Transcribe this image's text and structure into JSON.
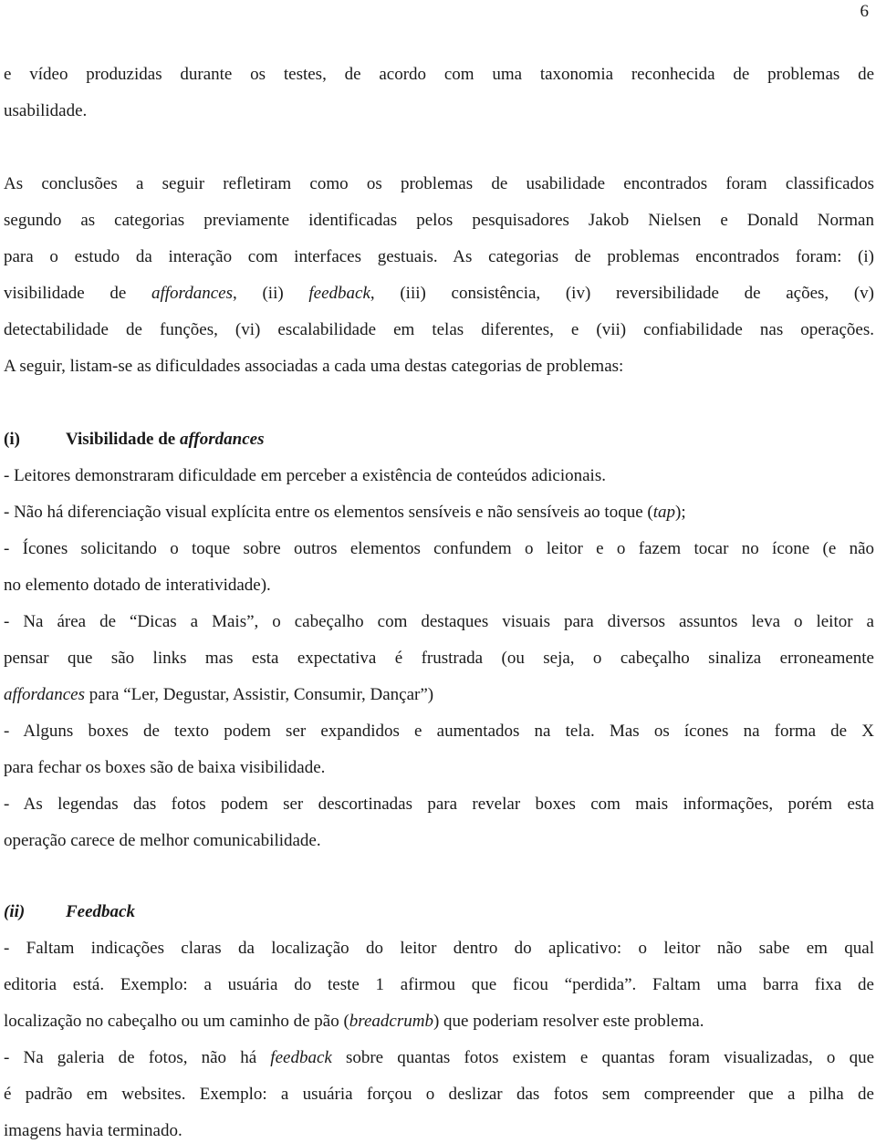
{
  "page_number": "6",
  "intro": {
    "line1": "e vídeo produzidas durante os testes, de acordo com uma taxonomia reconhecida de problemas de",
    "line2": "usabilidade."
  },
  "conclusions": {
    "l1": "As conclusões a seguir refletiram como os problemas de usabilidade encontrados foram classificados",
    "l2": "segundo as categorias previamente identificadas pelos pesquisadores Jakob Nielsen e Donald Norman",
    "l3": "para o estudo da interação com interfaces gestuais. As categorias de problemas encontrados foram: (i)",
    "l4a": "visibilidade de ",
    "l4b": "affordances",
    "l4c": ", (ii) ",
    "l4d": "feedback",
    "l4e": ", (iii) consistência, (iv) reversibilidade de ações, (v)",
    "l5": "detectabilidade de funções, (vi) escalabilidade em telas diferentes, e (vii) confiabilidade nas operações.",
    "l6": "A seguir, listam-se as dificuldades associadas a cada uma destas categorias de problemas:"
  },
  "section1": {
    "number": "(i)",
    "title_a": "Visibilidade de ",
    "title_b": "affordances",
    "b1": "- Leitores demonstraram dificuldade em perceber a existência de conteúdos adicionais.",
    "b2a": "- Não há diferenciação visual explícita entre os elementos sensíveis e não sensíveis ao toque (",
    "b2b": "tap",
    "b2c": ");",
    "b3l1": "- Ícones solicitando o toque sobre outros elementos confundem o leitor e o fazem tocar no ícone (e não",
    "b3l2": "no elemento dotado de interatividade).",
    "b4l1": "- Na área de “Dicas a Mais”, o cabeçalho com destaques visuais para diversos assuntos leva o leitor a",
    "b4l2": "pensar que são links mas esta expectativa é frustrada (ou seja, o cabeçalho sinaliza erroneamente",
    "b4l3a": "affordances",
    "b4l3b": " para “Ler, Degustar, Assistir, Consumir, Dançar”)",
    "b5l1": "- Alguns boxes de texto podem ser expandidos e aumentados na tela. Mas os ícones na forma de X",
    "b5l2": "para fechar os boxes são de baixa visibilidade.",
    "b6l1": "- As legendas das fotos podem ser descortinadas para revelar boxes com mais informações, porém esta",
    "b6l2": "operação carece de melhor comunicabilidade."
  },
  "section2": {
    "number": "(ii)",
    "title": "Feedback",
    "b1l1": "- Faltam indicações claras da localização do leitor dentro do aplicativo: o leitor não sabe em qual",
    "b1l2": "editoria está. Exemplo: a usuária do teste 1 afirmou que ficou “perdida”. Faltam uma barra fixa de",
    "b1l3a": "localização no cabeçalho ou um caminho de pão (",
    "b1l3b": "breadcrumb",
    "b1l3c": ") que poderiam resolver este problema.",
    "b2l1a": "- Na galeria de fotos, não há ",
    "b2l1b": "feedback",
    "b2l1c": " sobre quantas fotos existem e quantas foram visualizadas, o que",
    "b2l2": "é padrão em websites. Exemplo: a usuária forçou o deslizar das fotos sem compreender que a pilha de",
    "b2l3": "imagens havia terminado."
  }
}
